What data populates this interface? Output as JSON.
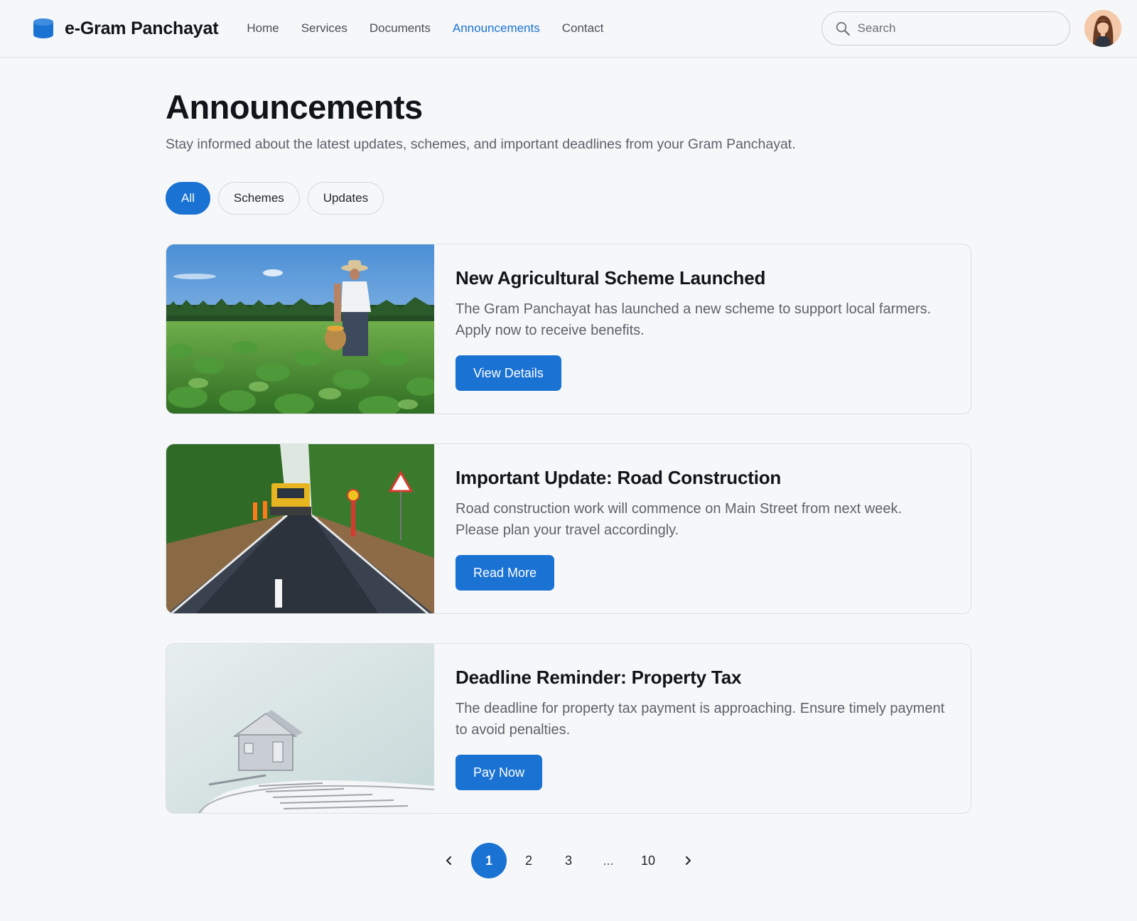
{
  "header": {
    "brand_name": "e-Gram Panchayat",
    "nav": [
      {
        "label": "Home",
        "active": false
      },
      {
        "label": "Services",
        "active": false
      },
      {
        "label": "Documents",
        "active": false
      },
      {
        "label": "Announcements",
        "active": true
      },
      {
        "label": "Contact",
        "active": false
      }
    ],
    "search_placeholder": "Search",
    "icons": {
      "brand": "database-icon",
      "search": "search-icon",
      "avatar": "user-avatar"
    }
  },
  "main": {
    "title": "Announcements",
    "subtitle": "Stay informed about the latest updates, schemes, and important deadlines from your Gram Panchayat.",
    "filters": [
      {
        "label": "All",
        "active": true
      },
      {
        "label": "Schemes",
        "active": false
      },
      {
        "label": "Updates",
        "active": false
      }
    ],
    "cards": [
      {
        "title": "New Agricultural Scheme Launched",
        "text": "The Gram Panchayat has launched a new scheme to support local farmers. Apply now to receive benefits.",
        "button": "View Details",
        "image": "farmer-field-photo"
      },
      {
        "title": "Important Update: Road Construction",
        "text": "Road construction work will commence on Main Street from next week. Please plan your travel accordingly.",
        "button": "Read More",
        "image": "road-construction-photo"
      },
      {
        "title": "Deadline Reminder: Property Tax",
        "text": "The deadline for property tax payment is approaching. Ensure timely payment to avoid penalties.",
        "button": "Pay Now",
        "image": "house-tax-document-photo"
      }
    ],
    "pagination": {
      "prev_icon": "chevron-left-icon",
      "next_icon": "chevron-right-icon",
      "pages": [
        "1",
        "2",
        "3",
        "...",
        "10"
      ],
      "current": "1"
    }
  },
  "colors": {
    "accent": "#1a72d3",
    "background": "#f6f7f9",
    "text": "#111418",
    "muted": "#5d626a"
  }
}
